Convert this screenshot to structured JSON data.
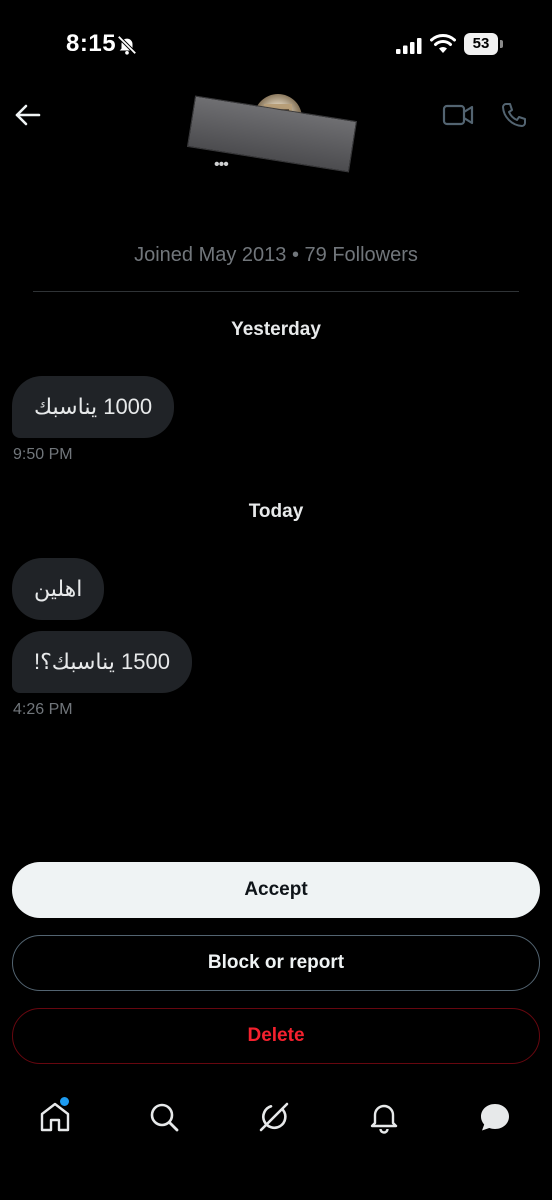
{
  "status_bar": {
    "time": "8:15",
    "battery": "53",
    "icons": [
      "bell-off-icon",
      "signal-icon",
      "wifi-icon",
      "battery-icon"
    ]
  },
  "header": {
    "icons": [
      "back-arrow-icon",
      "video-call-icon",
      "phone-call-icon"
    ],
    "name_obscured": "•••"
  },
  "profile": {
    "joined_text": "Joined May 2013 • 79 Followers"
  },
  "conversation": {
    "groups": [
      {
        "day": "Yesterday",
        "messages": [
          {
            "text": "1000 يناسبك"
          }
        ],
        "time": "9:50 PM"
      },
      {
        "day": "Today",
        "messages": [
          {
            "text": "اهلين"
          },
          {
            "text": "1500 يناسبك؟!"
          }
        ],
        "time": "4:26 PM"
      }
    ]
  },
  "actions": {
    "accept": "Accept",
    "block_or_report": "Block or report",
    "delete": "Delete"
  },
  "nav": {
    "items": [
      "home-icon",
      "search-icon",
      "grok-icon",
      "notifications-icon",
      "messages-icon"
    ]
  },
  "colors": {
    "background": "#000000",
    "bubble": "#202327",
    "muted": "#71767b",
    "accent": "#1d9bf0",
    "danger": "#f4212e"
  }
}
